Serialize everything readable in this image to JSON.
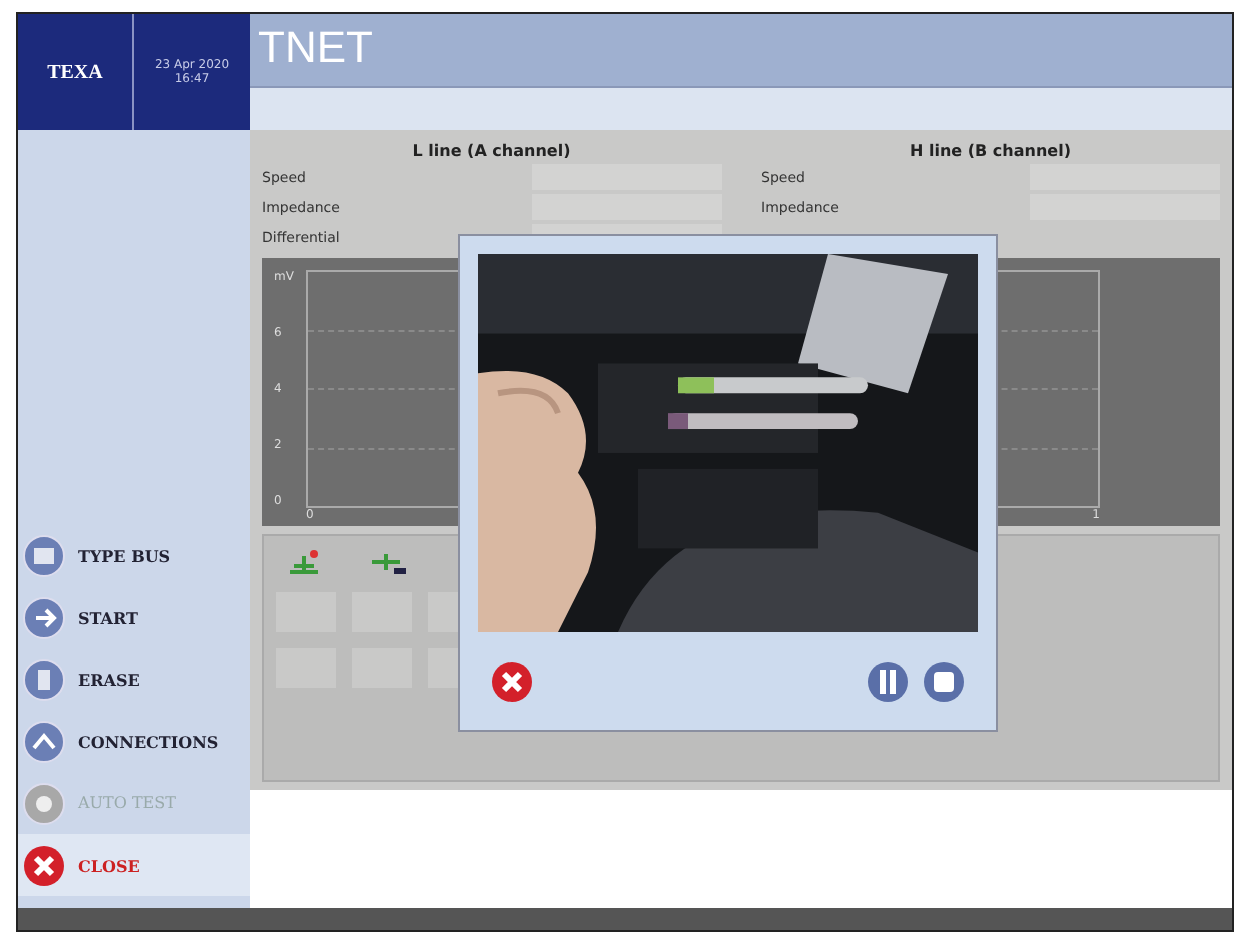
{
  "header": {
    "logo": "TEXA",
    "date": "23 Apr 2020",
    "time": "16:47",
    "title": "TNET"
  },
  "sidebar": {
    "items": [
      {
        "label": "TYPE BUS",
        "kind": "bus",
        "disabled": false
      },
      {
        "label": "START",
        "kind": "start",
        "disabled": false
      },
      {
        "label": "ERASE",
        "kind": "erase",
        "disabled": false
      },
      {
        "label": "CONNECTIONS",
        "kind": "connections",
        "disabled": false
      },
      {
        "label": "AUTO TEST",
        "kind": "auto",
        "disabled": true
      },
      {
        "label": "CLOSE",
        "kind": "close",
        "disabled": false
      }
    ]
  },
  "channels": [
    {
      "title": "L line (A channel)",
      "fields": [
        "Speed",
        "Impedance",
        "Differential"
      ]
    },
    {
      "title": "H line (B channel)",
      "fields": [
        "Speed",
        "Impedance"
      ]
    }
  ],
  "plot": {
    "unit": "mV",
    "yticks": [
      "6",
      "4",
      "2",
      "0"
    ],
    "xticks": [
      "0",
      "1"
    ]
  },
  "video_dialog": {
    "buttons": [
      {
        "kind": "close"
      },
      {
        "kind": "pause"
      },
      {
        "kind": "stop"
      }
    ]
  }
}
